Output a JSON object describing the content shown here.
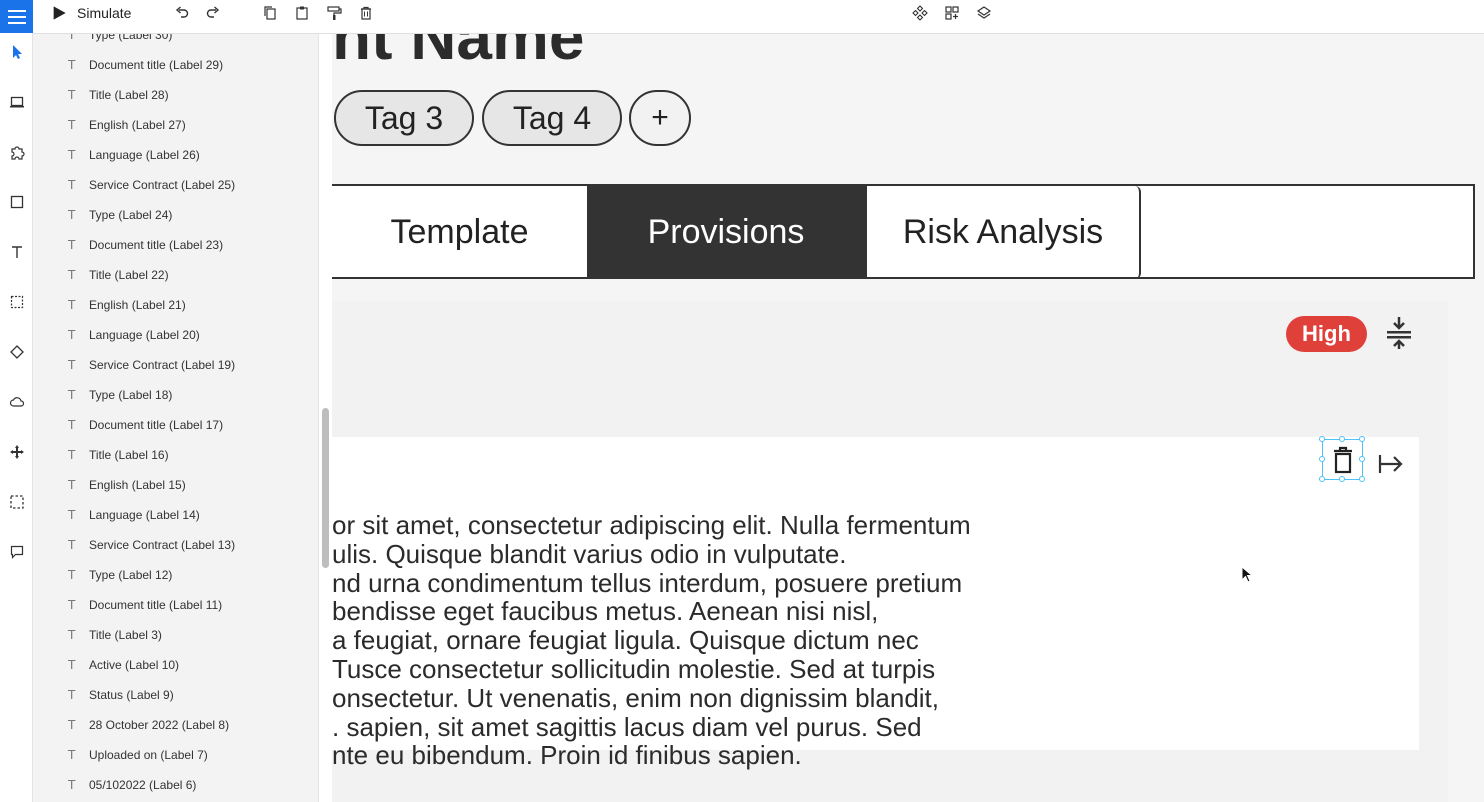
{
  "toolbar": {
    "simulate_label": "Simulate",
    "icons": [
      "play-icon",
      "undo-icon",
      "redo-icon",
      "copy-icon",
      "paste-icon",
      "format-painter-icon",
      "delete-icon",
      "component-icon",
      "grid-add-icon",
      "layers-icon"
    ]
  },
  "rail": {
    "icons": [
      "menu-icon",
      "pointer-icon",
      "laptop-icon",
      "puzzle-icon",
      "rectangle-icon",
      "text-icon",
      "dotted-rect-icon",
      "diamond-icon",
      "cloud-icon",
      "move-icon",
      "selection-icon",
      "comment-icon"
    ]
  },
  "layers": {
    "items": [
      "Type (Label 30)",
      "Document title (Label 29)",
      "Title (Label 28)",
      "English (Label 27)",
      "Language (Label 26)",
      "Service Contract (Label 25)",
      "Type (Label 24)",
      "Document title (Label 23)",
      "Title (Label 22)",
      "English (Label 21)",
      "Language (Label 20)",
      "Service Contract (Label 19)",
      "Type (Label 18)",
      "Document title (Label 17)",
      "Title (Label 16)",
      "English (Label 15)",
      "Language (Label 14)",
      "Service Contract (Label 13)",
      "Type (Label 12)",
      "Document title (Label 11)",
      "Title (Label 3)",
      "Active (Label 10)",
      "Status (Label 9)",
      "28 October 2022 (Label 8)",
      "Uploaded on (Label 7)",
      "05/102022 (Label 6)"
    ]
  },
  "canvas": {
    "title": "nt Name",
    "tags": [
      "Tag 3",
      "Tag 4"
    ],
    "add_tag": "+",
    "tabs": [
      "Template",
      "Provisions",
      "Risk Analysis"
    ],
    "active_tab": "Provisions",
    "risk_badge": "High",
    "body_text": "or sit amet, consectetur adipiscing elit. Nulla fermentum\nulis. Quisque blandit varius odio in vulputate.\nnd urna condimentum tellus interdum, posuere pretium\nbendisse eget faucibus metus. Aenean nisi nisl,\na feugiat, ornare feugiat ligula. Quisque dictum nec\nTusce consectetur sollicitudin molestie. Sed at turpis\nonsectetur. Ut venenatis, enim non dignissim blandit,\n. sapien, sit amet sagittis lacus diam vel purus. Sed\nnte eu bibendum. Proin id finibus sapien."
  },
  "colors": {
    "accent": "#1a73e8",
    "badge_red": "#e0403a",
    "selection": "#4fc3f7",
    "dark_tab": "#333333"
  }
}
